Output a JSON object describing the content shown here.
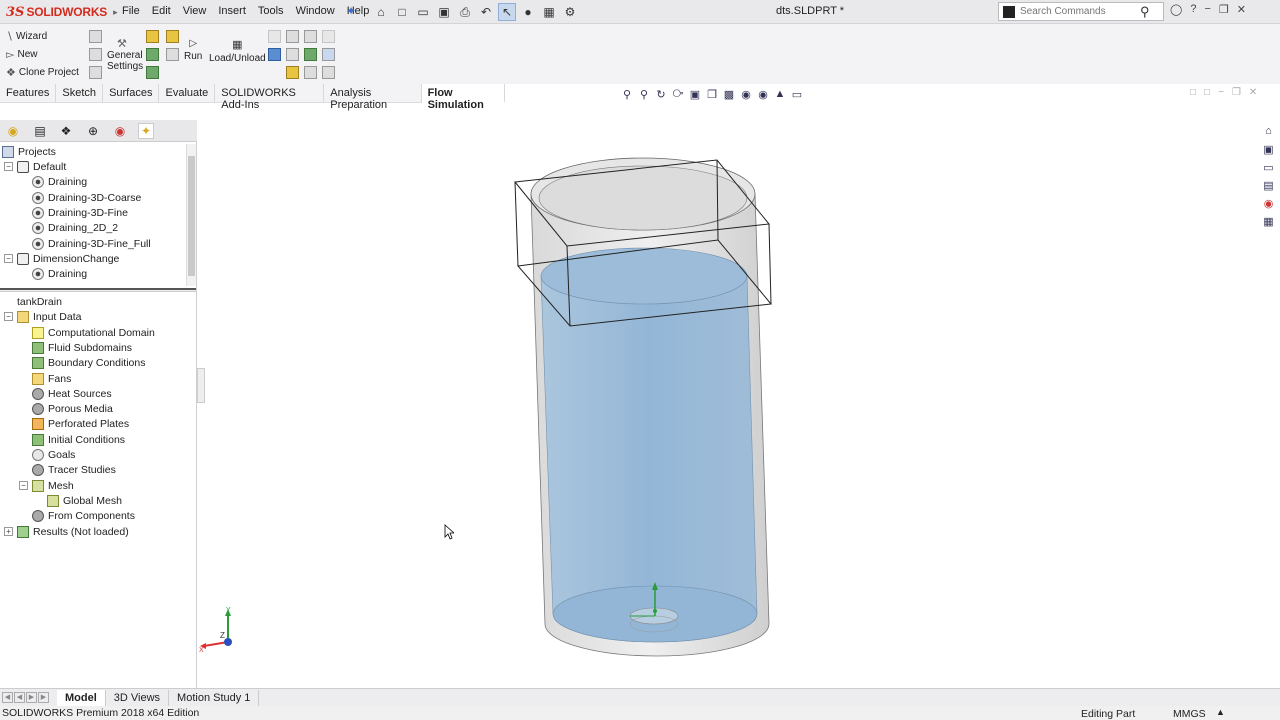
{
  "app": {
    "logo_prefix": "3S",
    "logo_text": "SOLIDWORKS",
    "document_title": "dts.SLDPRT *"
  },
  "menu": [
    "File",
    "Edit",
    "View",
    "Insert",
    "Tools",
    "Window",
    "Help"
  ],
  "search": {
    "placeholder": "Search Commands"
  },
  "commands": {
    "wizard": "Wizard",
    "new": "New",
    "clone_project": "Clone Project",
    "general_settings_line1": "General",
    "general_settings_line2": "Settings",
    "run": "Run",
    "load_unload": "Load/Unload"
  },
  "tabs": [
    "Features",
    "Sketch",
    "Surfaces",
    "Evaluate",
    "SOLIDWORKS Add-Ins",
    "Analysis Preparation",
    "Flow Simulation"
  ],
  "active_tab": "Flow Simulation",
  "projects_tree": {
    "root": "Projects",
    "items": [
      {
        "label": "Default",
        "level": 1,
        "type": "config"
      },
      {
        "label": "Draining",
        "level": 2,
        "type": "eye"
      },
      {
        "label": "Draining-3D-Coarse",
        "level": 2,
        "type": "eye"
      },
      {
        "label": "Draining-3D-Fine",
        "level": 2,
        "type": "eye"
      },
      {
        "label": "Draining_2D_2",
        "level": 2,
        "type": "eye"
      },
      {
        "label": "Draining-3D-Fine_Full",
        "level": 2,
        "type": "eye"
      },
      {
        "label": "DimensionChange",
        "level": 1,
        "type": "config"
      },
      {
        "label": "Draining",
        "level": 2,
        "type": "eye"
      }
    ]
  },
  "analysis_tree": {
    "root": "tankDrain",
    "input_data": "Input Data",
    "items": [
      {
        "label": "Computational Domain",
        "icon": "dom"
      },
      {
        "label": "Fluid Subdomains",
        "icon": "green"
      },
      {
        "label": "Boundary Conditions",
        "icon": "green"
      },
      {
        "label": "Fans",
        "icon": "fold"
      },
      {
        "label": "Heat Sources",
        "icon": "gear"
      },
      {
        "label": "Porous Media",
        "icon": "gear"
      },
      {
        "label": "Perforated Plates",
        "icon": "plate"
      },
      {
        "label": "Initial Conditions",
        "icon": "green"
      },
      {
        "label": "Goals",
        "icon": "goal"
      },
      {
        "label": "Tracer Studies",
        "icon": "gear"
      }
    ],
    "mesh": "Mesh",
    "global_mesh": "Global Mesh",
    "from_components": "From Components",
    "results": "Results (Not loaded)"
  },
  "bottom_tabs": [
    "Model",
    "3D Views",
    "Motion Study 1"
  ],
  "active_bottom_tab": "Model",
  "status": {
    "edition": "SOLIDWORKS Premium 2018 x64 Edition",
    "mode": "Editing Part",
    "units": "MMGS"
  },
  "triad": {
    "x": "X",
    "y": "Y",
    "z": "Z"
  },
  "colors": {
    "brand": "#d52b1e",
    "fluid": "#8fb4d6",
    "accent": "#3b6fd1"
  }
}
